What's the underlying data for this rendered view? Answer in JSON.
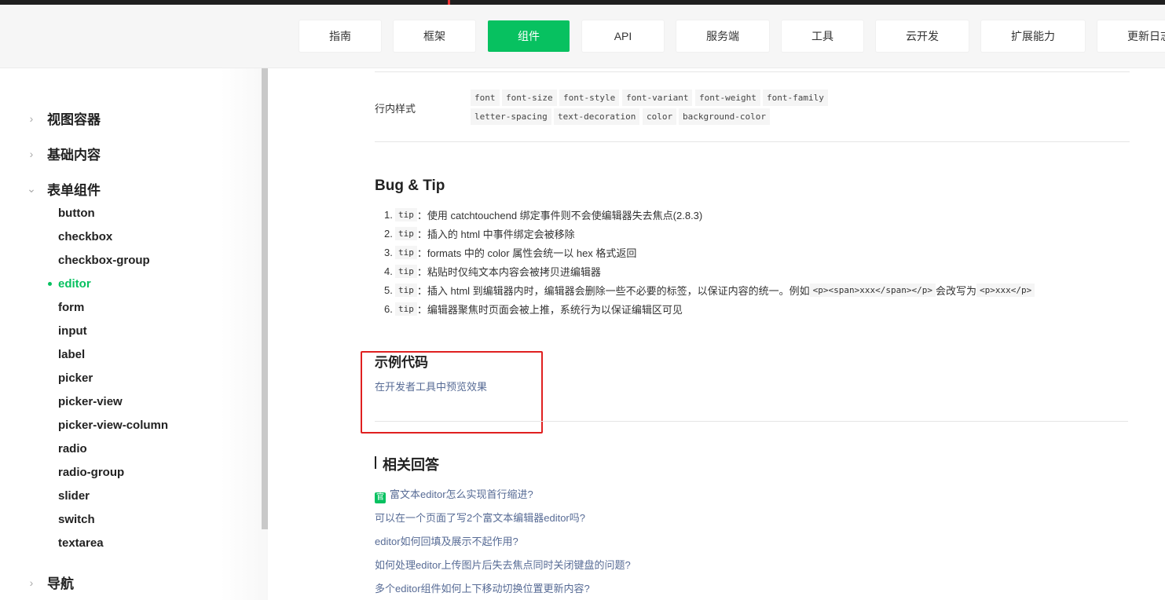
{
  "nav": [
    "指南",
    "框架",
    "组件",
    "API",
    "服务端",
    "工具",
    "云开发",
    "扩展能力",
    "更新日志"
  ],
  "nav_active": "组件",
  "sidebar": {
    "categories": [
      "视图容器",
      "基础内容",
      "表单组件",
      "导航"
    ],
    "form_items": [
      "button",
      "checkbox",
      "checkbox-group",
      "editor",
      "form",
      "input",
      "label",
      "picker",
      "picker-view",
      "picker-view-column",
      "radio",
      "radio-group",
      "slider",
      "switch",
      "textarea"
    ],
    "active_item": "editor"
  },
  "inline_style": {
    "label": "行内样式",
    "row1": [
      "font",
      "font-size",
      "font-style",
      "font-variant",
      "font-weight",
      "font-family"
    ],
    "row2": [
      "letter-spacing",
      "text-decoration",
      "color",
      "background-color"
    ]
  },
  "bugtip": {
    "title": "Bug & Tip",
    "items": [
      {
        "num": "1.",
        "tag": "tip",
        "text": "：使用 catchtouchend 绑定事件则不会使编辑器失去焦点(2.8.3)"
      },
      {
        "num": "2.",
        "tag": "tip",
        "text": "：插入的 html 中事件绑定会被移除"
      },
      {
        "num": "3.",
        "tag": "tip",
        "text": "：formats 中的 color 属性会统一以 hex 格式返回"
      },
      {
        "num": "4.",
        "tag": "tip",
        "text": "：粘贴时仅纯文本内容会被拷贝进编辑器"
      },
      {
        "num": "5.",
        "tag": "tip",
        "text": "：插入 html 到编辑器内时，编辑器会删除一些不必要的标签，以保证内容的统一。例如 ",
        "code1": "<p><span>xxx</span></p>",
        "mid": " 会改写为 ",
        "code2": "<p>xxx</p>"
      },
      {
        "num": "6.",
        "tag": "tip",
        "text": "：编辑器聚焦时页面会被上推，系统行为以保证编辑区可见"
      }
    ]
  },
  "example": {
    "title": "示例代码",
    "link": "在开发者工具中预览效果"
  },
  "related": {
    "title": "相关回答",
    "badge": "官",
    "links": [
      "富文本editor怎么实现首行缩进?",
      "可以在一个页面了写2个富文本编辑器editor吗?",
      "editor如何回填及展示不起作用?",
      "如何处理editor上传图片后失去焦点同时关闭键盘的问题?",
      "多个editor组件如何上下移动切换位置更新内容?"
    ]
  },
  "colors": {
    "accent": "#07c160",
    "link": "#576b95",
    "highlight": "#e02020"
  }
}
